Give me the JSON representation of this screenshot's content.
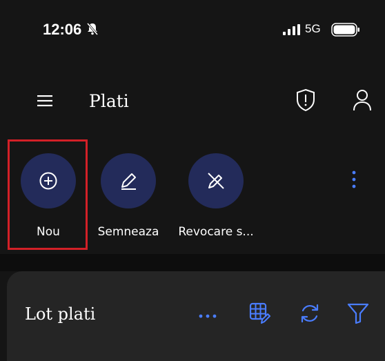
{
  "status_bar": {
    "time": "12:06",
    "silent_icon": "bell-slash-icon",
    "network": "5G",
    "signal_icon": "signal-icon",
    "battery_icon": "battery-icon"
  },
  "header": {
    "title": "Plati",
    "menu_icon": "hamburger-menu-icon",
    "security_icon": "shield-alert-icon",
    "profile_icon": "user-icon"
  },
  "actions": [
    {
      "label": "Nou",
      "icon": "plus-circle-icon"
    },
    {
      "label": "Semneaza",
      "icon": "pen-icon"
    },
    {
      "label": "Revocare s...",
      "icon": "pen-off-icon"
    }
  ],
  "more_actions_icon": "vertical-dots-icon",
  "card": {
    "title": "Lot plati",
    "icons": [
      "more-horizontal-icon",
      "table-edit-icon",
      "refresh-icon",
      "filter-icon"
    ]
  },
  "colors": {
    "background": "#151515",
    "action_circle": "#232b5a",
    "accent": "#4a7dff",
    "highlight": "#d32027",
    "card": "#252525"
  }
}
